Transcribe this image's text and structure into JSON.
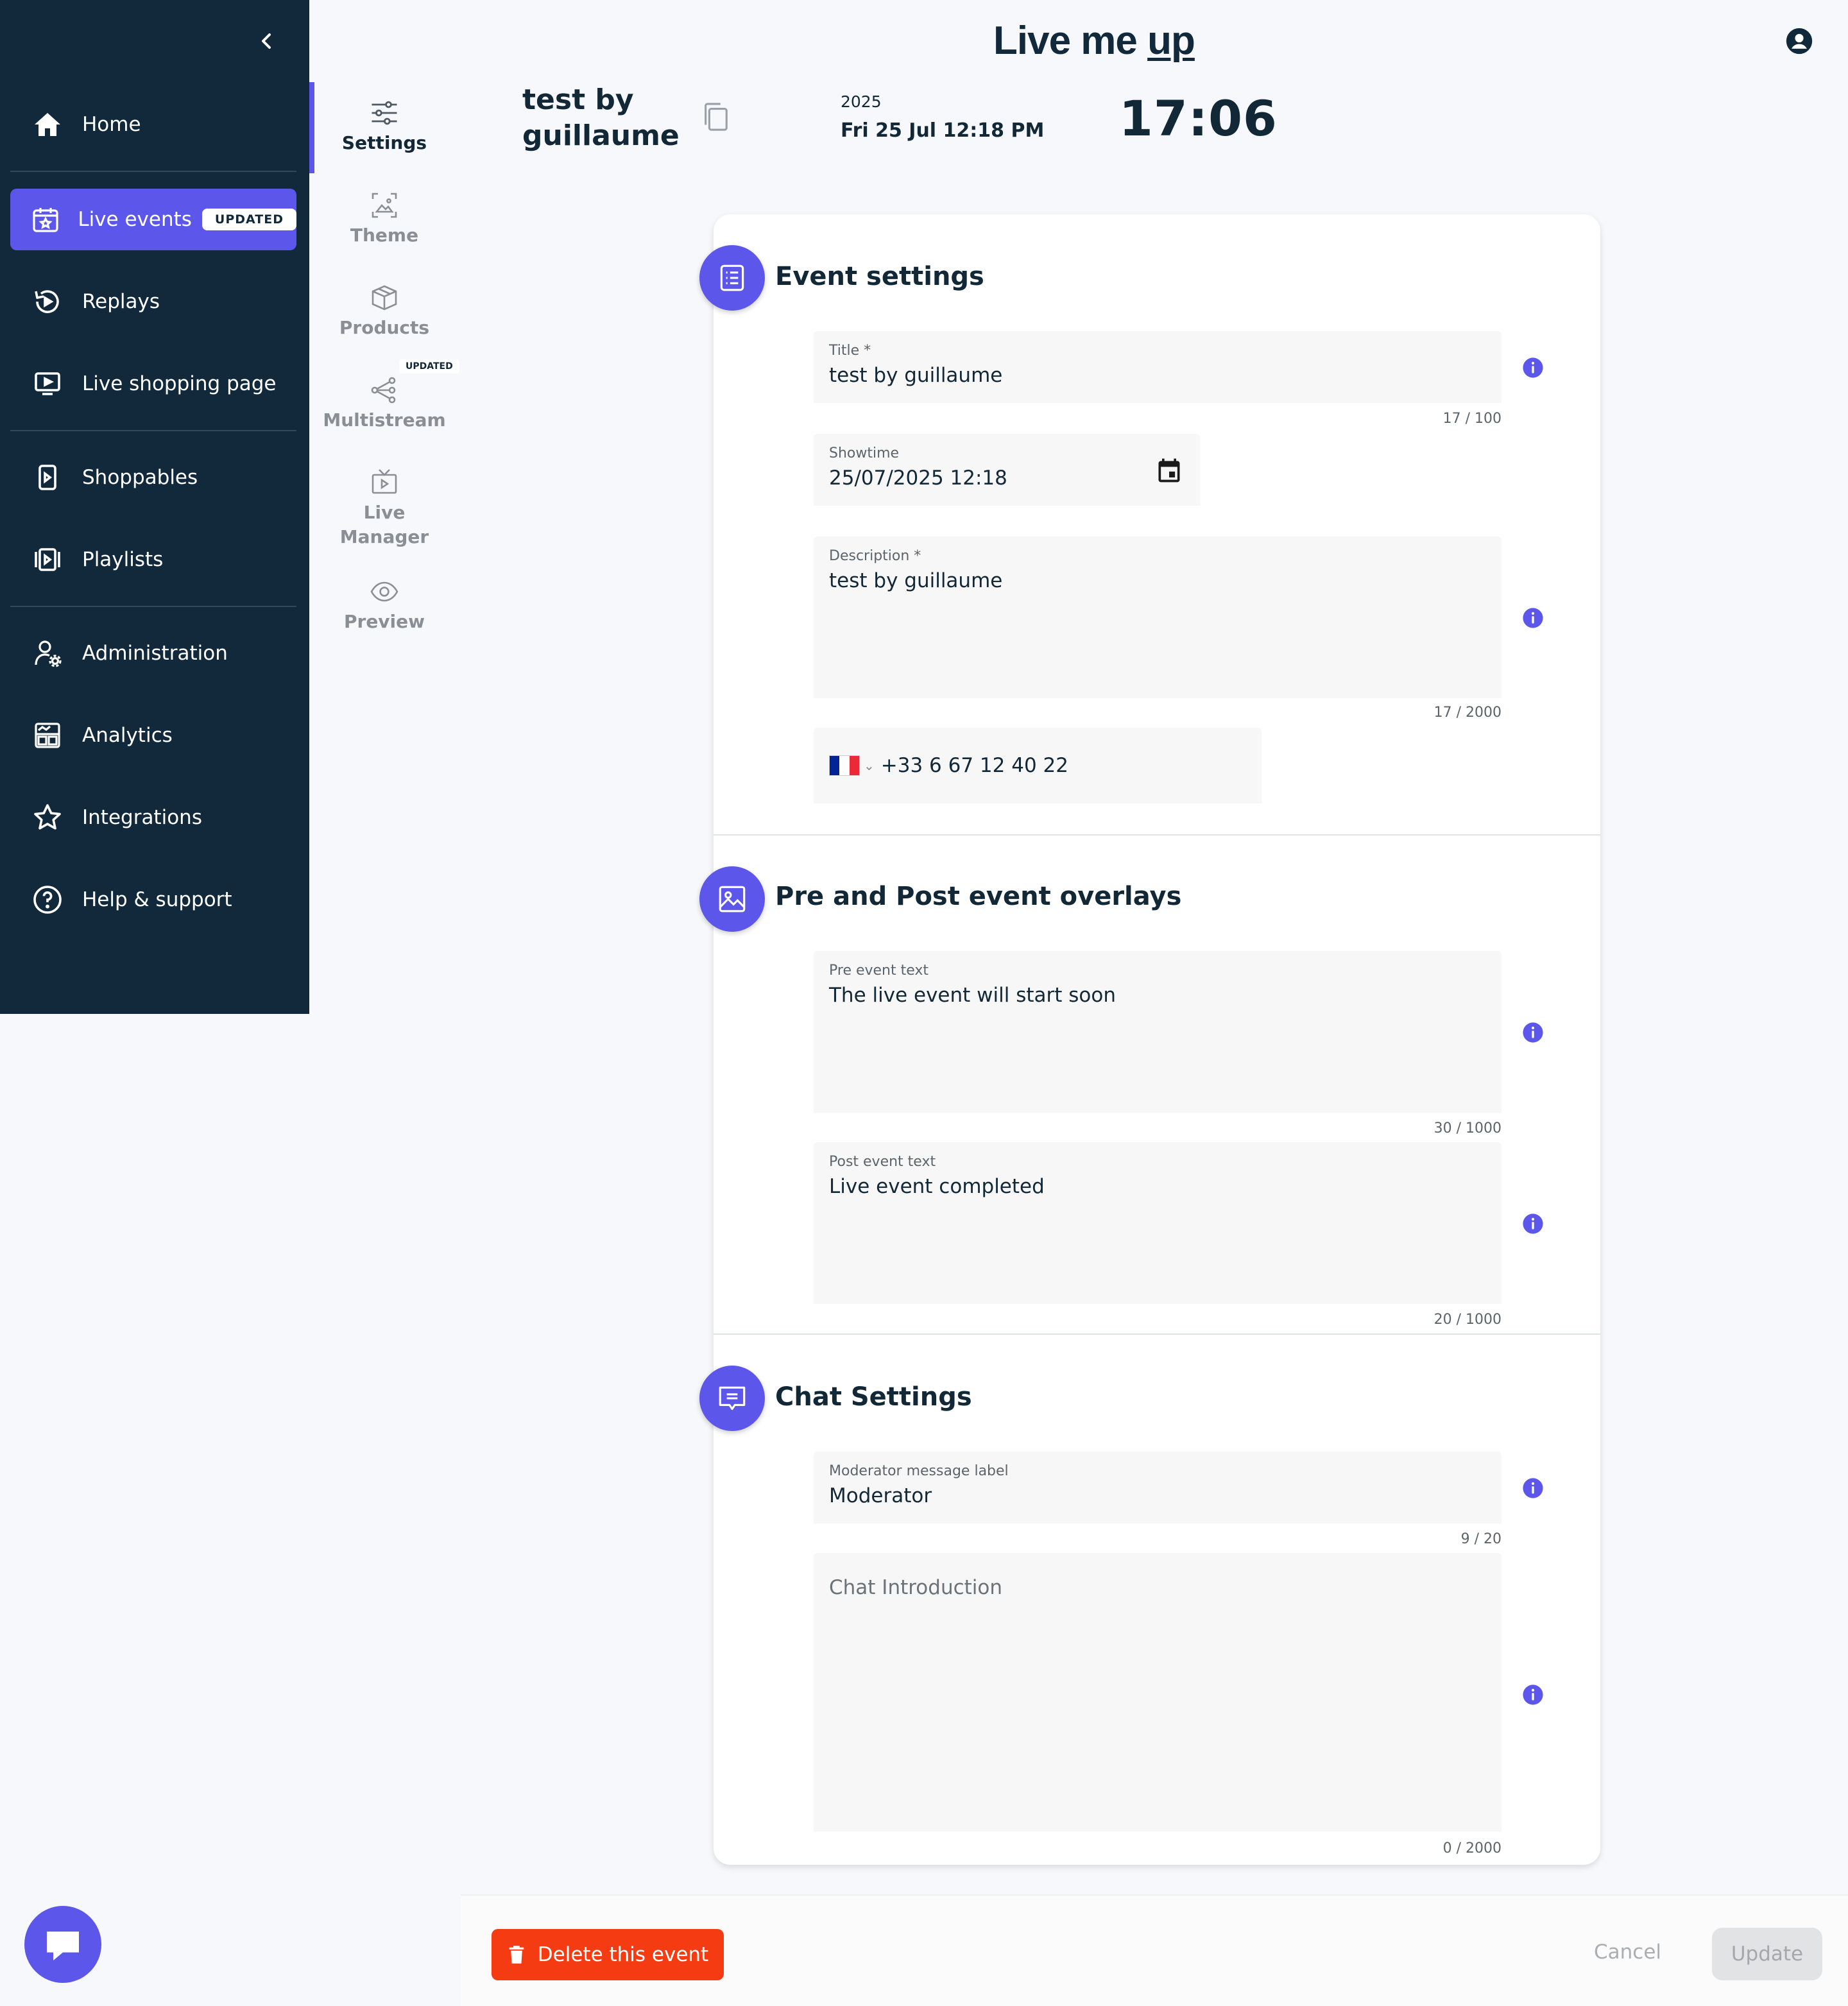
{
  "sidebar": {
    "items": [
      {
        "label": "Home",
        "icon": "home-icon"
      },
      {
        "label": "Live events",
        "icon": "calendar-star-icon",
        "badge": "UPDATED",
        "active": true
      },
      {
        "label": "Replays",
        "icon": "replay-icon"
      },
      {
        "label": "Live shopping page",
        "icon": "screen-play-icon"
      },
      {
        "label": "Shoppables",
        "icon": "shoppable-icon"
      },
      {
        "label": "Playlists",
        "icon": "playlist-icon"
      },
      {
        "label": "Administration",
        "icon": "user-gear-icon"
      },
      {
        "label": "Analytics",
        "icon": "analytics-icon"
      },
      {
        "label": "Integrations",
        "icon": "star-outline-icon"
      },
      {
        "label": "Help & support",
        "icon": "help-icon"
      }
    ]
  },
  "subnav": {
    "items": [
      {
        "label": "Settings",
        "icon": "sliders-icon",
        "active": true
      },
      {
        "label": "Theme",
        "icon": "theme-icon"
      },
      {
        "label": "Products",
        "icon": "box-icon"
      },
      {
        "label": "Multistream",
        "icon": "share-nodes-icon",
        "badge": "UPDATED"
      },
      {
        "label": "Live\nManager",
        "icon": "tv-play-icon"
      },
      {
        "label": "Preview",
        "icon": "eye-icon"
      }
    ]
  },
  "header": {
    "logo": {
      "main": "Live me ",
      "accent": "up"
    },
    "event_title": "test by guillaume",
    "date_year": "2025",
    "date_full": "Fri 25 Jul 12:18 PM",
    "countdown": "17:06"
  },
  "sections": {
    "event_settings": {
      "title": "Event settings",
      "title_field": {
        "label": "Title *",
        "value": "test by guillaume",
        "counter": "17 / 100"
      },
      "showtime_field": {
        "label": "Showtime",
        "value": "25/07/2025 12:18"
      },
      "description_field": {
        "label": "Description *",
        "value": "test by guillaume",
        "counter": "17 / 2000"
      },
      "phone_field": {
        "value": "+33 6 67 12 40 22",
        "flag_colors": [
          "#002395",
          "#ffffff",
          "#ed2939"
        ]
      }
    },
    "overlays": {
      "title": "Pre and Post event overlays",
      "pre_field": {
        "label": "Pre event text",
        "value": "The live event will start soon",
        "counter": "30 / 1000"
      },
      "post_field": {
        "label": "Post event text",
        "value": "Live event completed",
        "counter": "20 / 1000"
      }
    },
    "chat": {
      "title": "Chat Settings",
      "moderator_field": {
        "label": "Moderator message label",
        "value": "Moderator",
        "counter": "9 / 20"
      },
      "intro_field": {
        "placeholder": "Chat Introduction",
        "counter": "0 / 2000"
      }
    }
  },
  "footer": {
    "delete_label": "Delete this event",
    "cancel_label": "Cancel",
    "update_label": "Update"
  },
  "colors": {
    "sidebar_bg": "#11293a",
    "accent": "#5c57ea",
    "danger": "#f43b12"
  }
}
